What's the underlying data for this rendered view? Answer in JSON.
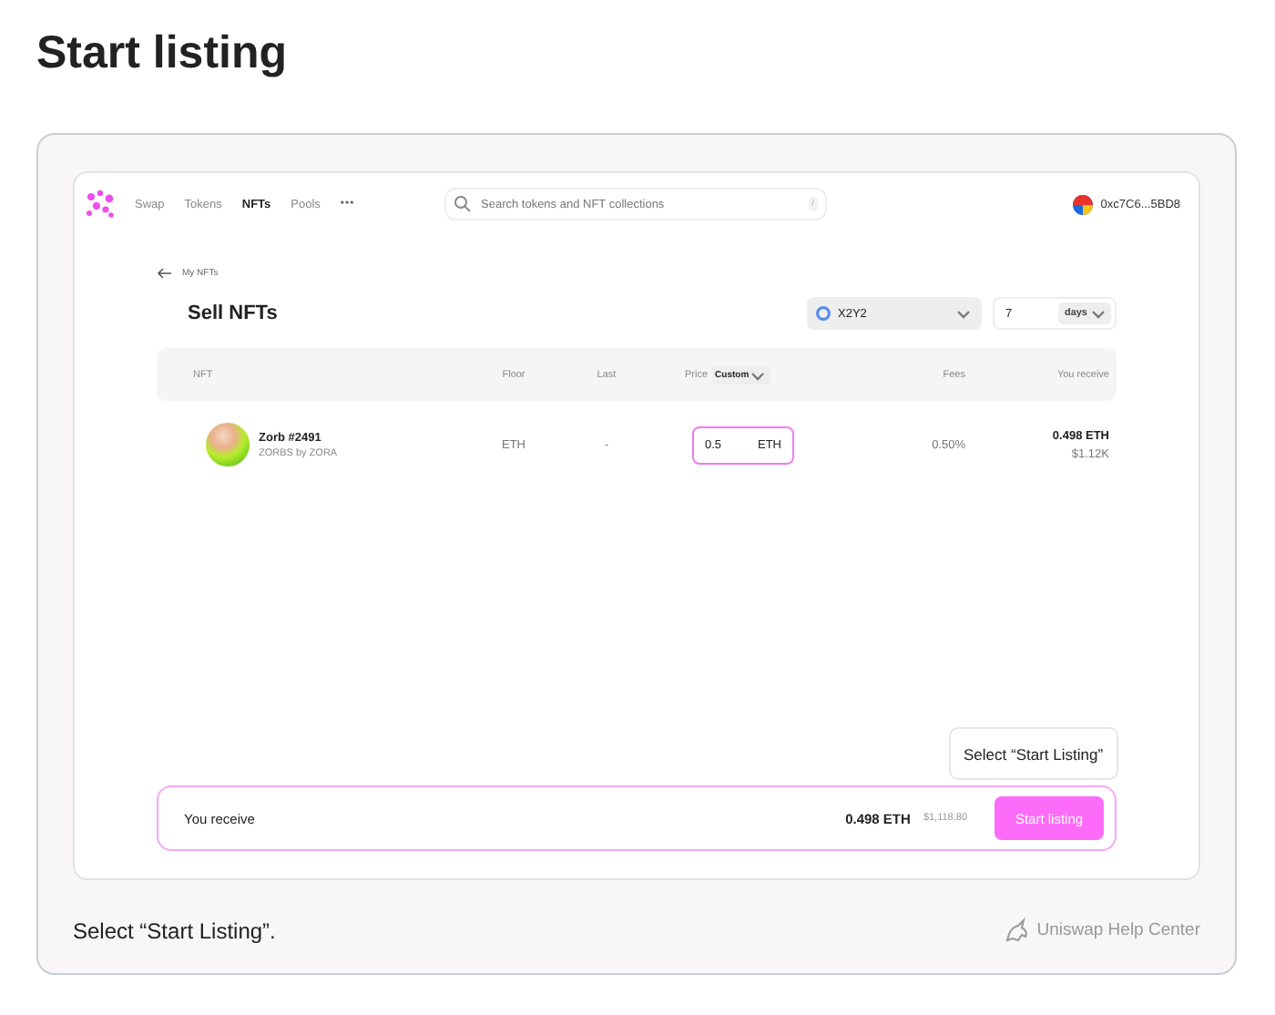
{
  "heading": "Start listing",
  "nav": {
    "items": [
      {
        "label": "Swap",
        "selected": false
      },
      {
        "label": "Tokens",
        "selected": false
      },
      {
        "label": "NFTs",
        "selected": true
      },
      {
        "label": "Pools",
        "selected": false
      }
    ],
    "more": "•••",
    "search": {
      "placeholder": "Search tokens and NFT collections",
      "shortcut": "/"
    },
    "account": "0xc7C6...5BD8"
  },
  "back_link": "My NFTs",
  "page_title": "Sell NFTs",
  "marketplace": "X2Y2",
  "duration": {
    "value": "7",
    "unit": "days"
  },
  "table": {
    "columns": [
      "NFT",
      "Floor",
      "Last",
      "Price",
      "Fees",
      "You receive"
    ],
    "price_mode": "Custom",
    "rows": [
      {
        "name": "Zorb #2491",
        "collection": "ZORBS by ZORA",
        "floor": "ETH",
        "last": "-",
        "price": "0.5",
        "currency": "ETH",
        "fees": "0.50%",
        "receive": "0.498 ETH",
        "receive_usd": "$1.12K"
      }
    ]
  },
  "footer": {
    "label": "You receive",
    "amount": "0.498 ETH",
    "usd": "$1,118.80",
    "button": "Start listing"
  },
  "tooltip": "Select “Start Listing”",
  "caption": "Select “Start Listing”.",
  "source": "Uniswap Help Center"
}
